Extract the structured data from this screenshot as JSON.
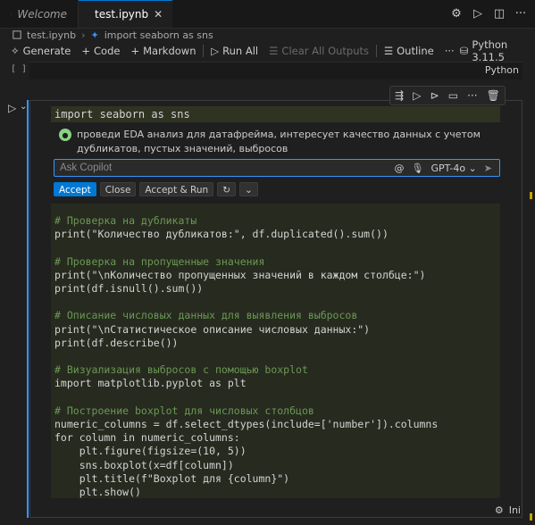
{
  "tabs": [
    {
      "label": "Welcome",
      "active": false
    },
    {
      "label": "test.ipynb",
      "active": true
    }
  ],
  "breadcrumb": [
    "test.ipynb",
    "import seaborn as sns"
  ],
  "toolbar": {
    "generate": "Generate",
    "code": "Code",
    "markdown": "Markdown",
    "run_all": "Run All",
    "clear_outputs": "Clear All Outputs",
    "outline": "Outline",
    "more": "···",
    "kernel": "Python 3.11.5"
  },
  "cell0": {
    "bracket": "[ ]",
    "language": "Python"
  },
  "cell1": {
    "first_line": "import seaborn as sns",
    "copilot_message": "проведи EDA анализ для датафрейма, интересует качество данных с учетом дубликатов, пустых значений, выбросов",
    "ask_placeholder": "Ask Copilot",
    "model": "GPT-4o",
    "buttons": {
      "accept": "Accept",
      "close": "Close",
      "accept_run": "Accept & Run"
    },
    "code": [
      {
        "t": "c",
        "s": "# Проверка на дубликаты"
      },
      {
        "t": "x",
        "s": "print(\"Количество дубликатов:\", df.duplicated().sum())"
      },
      {
        "t": "b",
        "s": ""
      },
      {
        "t": "c",
        "s": "# Проверка на пропущенные значения"
      },
      {
        "t": "x",
        "s": "print(\"\\nКоличество пропущенных значений в каждом столбце:\")"
      },
      {
        "t": "x",
        "s": "print(df.isnull().sum())"
      },
      {
        "t": "b",
        "s": ""
      },
      {
        "t": "c",
        "s": "# Описание числовых данных для выявления выбросов"
      },
      {
        "t": "x",
        "s": "print(\"\\nСтатистическое описание числовых данных:\")"
      },
      {
        "t": "x",
        "s": "print(df.describe())"
      },
      {
        "t": "b",
        "s": ""
      },
      {
        "t": "c",
        "s": "# Визуализация выбросов с помощью boxplot"
      },
      {
        "t": "x",
        "s": "import matplotlib.pyplot as plt"
      },
      {
        "t": "b",
        "s": ""
      },
      {
        "t": "c",
        "s": "# Построение boxplot для числовых столбцов"
      },
      {
        "t": "x",
        "s": "numeric_columns = df.select_dtypes(include=['number']).columns"
      },
      {
        "t": "x",
        "s": "for column in numeric_columns:"
      },
      {
        "t": "x",
        "s": "    plt.figure(figsize=(10, 5))"
      },
      {
        "t": "x",
        "s": "    sns.boxplot(x=df[column])"
      },
      {
        "t": "x",
        "s": "    plt.title(f\"Boxplot для {column}\")"
      },
      {
        "t": "x",
        "s": "    plt.show()"
      }
    ],
    "status_lang": "Ini"
  },
  "icons": {
    "run_cell": "play-icon",
    "more": "ellipsis-icon",
    "delete": "trash-icon"
  }
}
